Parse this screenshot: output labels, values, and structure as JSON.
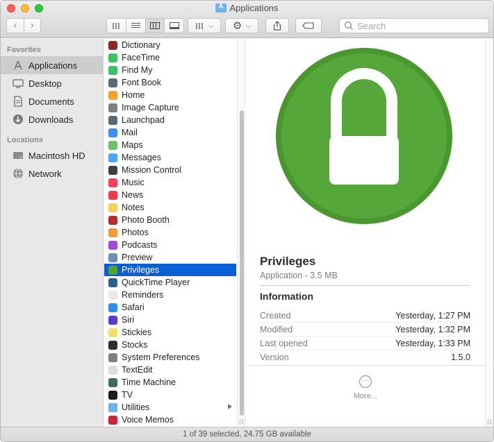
{
  "window": {
    "title": "Applications"
  },
  "toolbar": {
    "back_label": "‹",
    "forward_label": "›",
    "search_placeholder": "Search"
  },
  "sidebar": {
    "favorites_header": "Favorites",
    "favorites": [
      {
        "label": "Applications",
        "icon": "applications-icon",
        "selected": true
      },
      {
        "label": "Desktop",
        "icon": "desktop-icon"
      },
      {
        "label": "Documents",
        "icon": "documents-icon"
      },
      {
        "label": "Downloads",
        "icon": "downloads-icon"
      }
    ],
    "locations_header": "Locations",
    "locations": [
      {
        "label": "Macintosh HD",
        "icon": "hard-drive-icon"
      },
      {
        "label": "Network",
        "icon": "network-globe-icon"
      }
    ]
  },
  "files": [
    {
      "label": "Dictionary",
      "color": "#8b2a2a"
    },
    {
      "label": "FaceTime",
      "color": "#34c759"
    },
    {
      "label": "Find My",
      "color": "#3ac26a"
    },
    {
      "label": "Font Book",
      "color": "#5f6b74"
    },
    {
      "label": "Home",
      "color": "#f7a22b"
    },
    {
      "label": "Image Capture",
      "color": "#7a7f85"
    },
    {
      "label": "Launchpad",
      "color": "#596875"
    },
    {
      "label": "Mail",
      "color": "#3d8ef7"
    },
    {
      "label": "Maps",
      "color": "#6cc16a"
    },
    {
      "label": "Messages",
      "color": "#4aa7f5"
    },
    {
      "label": "Mission Control",
      "color": "#3b3f46"
    },
    {
      "label": "Music",
      "color": "#fa3c5a"
    },
    {
      "label": "News",
      "color": "#f5384a"
    },
    {
      "label": "Notes",
      "color": "#f6d15b"
    },
    {
      "label": "Photo Booth",
      "color": "#b52c2c"
    },
    {
      "label": "Photos",
      "color": "#f29b36"
    },
    {
      "label": "Podcasts",
      "color": "#9c4ed8"
    },
    {
      "label": "Preview",
      "color": "#6f8fb0"
    },
    {
      "label": "Privileges",
      "color": "#4ea62d",
      "selected": true
    },
    {
      "label": "QuickTime Player",
      "color": "#2b5e8c"
    },
    {
      "label": "Reminders",
      "color": "#e9e9e9"
    },
    {
      "label": "Safari",
      "color": "#2e8ff0"
    },
    {
      "label": "Siri",
      "color": "#5b3ad1"
    },
    {
      "label": "Stickies",
      "color": "#f4de68"
    },
    {
      "label": "Stocks",
      "color": "#2e2e2e"
    },
    {
      "label": "System Preferences",
      "color": "#7b7f86"
    },
    {
      "label": "TextEdit",
      "color": "#dedede"
    },
    {
      "label": "Time Machine",
      "color": "#3e6e5e"
    },
    {
      "label": "TV",
      "color": "#1c1c1c"
    },
    {
      "label": "Utilities",
      "color": "#6cb5ec",
      "folder": true
    },
    {
      "label": "Voice Memos",
      "color": "#d0243b"
    }
  ],
  "preview": {
    "name": "Privileges",
    "kind": "Application - 3.5 MB",
    "info_header": "Information",
    "rows": [
      {
        "key": "Created",
        "value": "Yesterday, 1:27 PM"
      },
      {
        "key": "Modified",
        "value": "Yesterday, 1:32 PM"
      },
      {
        "key": "Last opened",
        "value": "Yesterday, 1:33 PM"
      },
      {
        "key": "Version",
        "value": "1.5.0"
      }
    ],
    "more_label": "More...",
    "icon_color": "#56a73a"
  },
  "status": {
    "text": "1 of 39 selected, 24.75 GB available"
  }
}
